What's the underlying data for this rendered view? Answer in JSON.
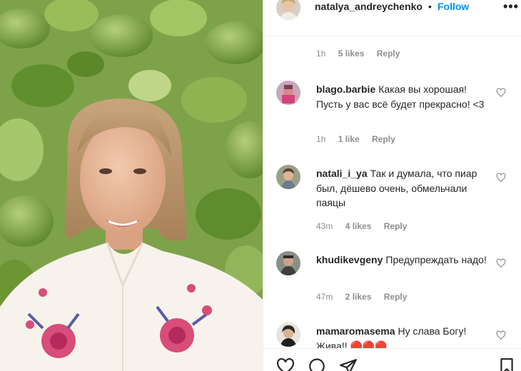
{
  "post": {
    "author": "natalya_andreychenko",
    "separator": "•",
    "follow_label": "Follow",
    "more_label": "•••",
    "caption_meta": {
      "time": "1h",
      "likes": "5 likes",
      "reply": "Reply"
    }
  },
  "comments": [
    {
      "user": "blago.barbie",
      "text": "Какая вы хорошая! Пусть у вас всё будет прекрасно! <3",
      "time": "1h",
      "likes": "1 like",
      "reply": "Reply"
    },
    {
      "user": "natali_i_ya",
      "text": "Так и думала, что пиар был, дёшево очень, обмельчали паяцы",
      "time": "43m",
      "likes": "4 likes",
      "reply": "Reply"
    },
    {
      "user": "khudikevgeny",
      "text": "Предупреждать надо!",
      "time": "47m",
      "likes": "2 likes",
      "reply": "Reply"
    },
    {
      "user": "mamaromasema",
      "text": "Ну слава Богу! Жива!! 🔴🔴🔴",
      "time": "",
      "likes": "",
      "reply": ""
    }
  ],
  "icons": {
    "heart": "heart-icon",
    "comment": "comment-icon",
    "share": "share-icon",
    "save": "bookmark-icon",
    "more": "more-options-icon"
  },
  "colors": {
    "follow_blue": "#0095f6",
    "text": "#262626",
    "muted": "#8e8e8e",
    "border": "#efefef"
  }
}
